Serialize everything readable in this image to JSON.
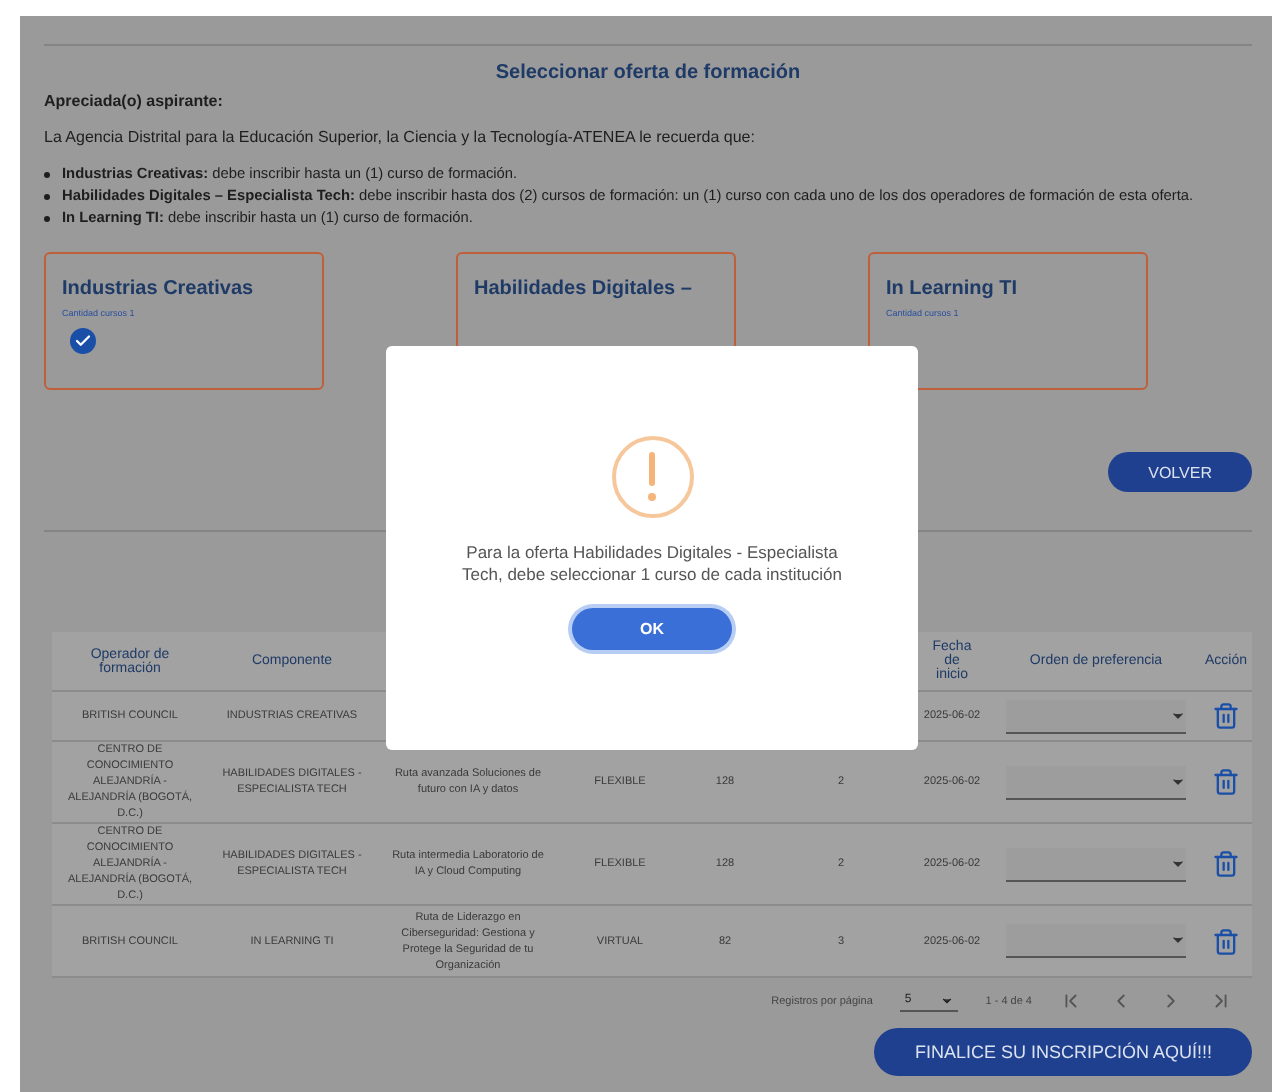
{
  "title": "Seleccionar oferta de formación",
  "greeting": "Apreciada(o) aspirante:",
  "intro": "La Agencia Distrital para la Educación Superior, la Ciencia y la Tecnología-ATENEA le recuerda que:",
  "rules": [
    "**Industrias Creativas:** debe inscribir hasta un (1) curso de formación.",
    "**Habilidades Digitales – Especialista Tech:** debe inscribir hasta dos (2) cursos de formación: un (1) curso con cada uno de los dos operadores de formación de esta oferta.",
    "**In Learning TI:** debe inscribir hasta un (1) curso de formación."
  ],
  "offers": [
    {
      "title": "Industrias Creativas",
      "count": "Cantidad cursos 1",
      "checked": true
    },
    {
      "title": "Habilidades Digitales –",
      "checked": false
    },
    {
      "title": "In Learning TI",
      "count": "Cantidad cursos 1",
      "checked": false
    }
  ],
  "back_button": "VOLVER",
  "table": {
    "columns": {
      "column_1": "Operador de formación",
      "column_2": "Componente",
      "column_7": "Fecha de inicio",
      "column_8": "Orden de preferencia",
      "column_9": "Acción"
    },
    "rows": [
      {
        "column_1": "BRITISH COUNCIL",
        "column_2": "INDUSTRIAS CREATIVAS",
        "column_7": "2025-06-02"
      },
      {
        "column_1": "CENTRO DE CONOCIMIENTO ALEJANDRÍA - ALEJANDRÍA (BOGOTÁ, D.C.)",
        "column_2": "HABILIDADES DIGITALES - ESPECIALISTA TECH",
        "column_3": "Ruta avanzada Soluciones de futuro con IA y datos",
        "column_4": "FLEXIBLE",
        "column_5": "128",
        "column_6": "2",
        "column_7": "2025-06-02"
      },
      {
        "column_1": "CENTRO DE CONOCIMIENTO ALEJANDRÍA - ALEJANDRÍA (BOGOTÁ, D.C.)",
        "column_2": "HABILIDADES DIGITALES - ESPECIALISTA TECH",
        "column_3": "Ruta intermedia Laboratorio de IA y Cloud Computing",
        "column_4": "FLEXIBLE",
        "column_5": "128",
        "column_6": "2",
        "column_7": "2025-06-02"
      },
      {
        "column_1": "BRITISH COUNCIL",
        "column_2": "IN LEARNING TI",
        "column_3": "Ruta de Liderazgo en Ciberseguridad: Gestiona y Protege la Seguridad de tu Organización",
        "column_4": "VIRTUAL",
        "column_5": "82",
        "column_6": "3",
        "column_7": "2025-06-02"
      }
    ]
  },
  "pagination": {
    "label": "Registros por página",
    "page_size": "5",
    "range": "1 - 4 de 4"
  },
  "finish_button": "FINALICE SU INSCRIPCIÓN AQUÍ!!!",
  "modal": {
    "message": "Para la oferta Habilidades Digitales - Especialista Tech, debe seleccionar 1 curso de cada institución",
    "ok_button": "OK"
  }
}
